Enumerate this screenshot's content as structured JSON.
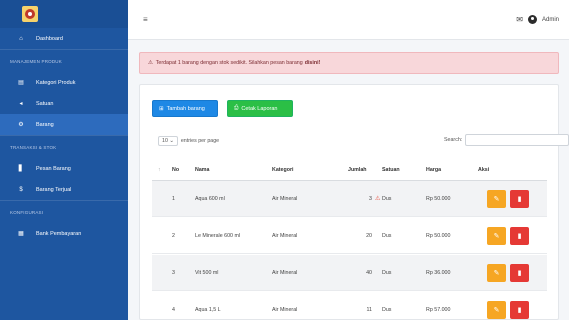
{
  "sidebar": {
    "items": [
      {
        "type": "item",
        "label": "Dashboard",
        "icon": "home-icon",
        "glyph": "⌂"
      },
      {
        "type": "section",
        "label": "MANAJEMEN PRODUK"
      },
      {
        "type": "item",
        "label": "Kategori Produk",
        "icon": "category-icon",
        "glyph": "▤"
      },
      {
        "type": "item",
        "label": "Satuan",
        "icon": "tag-icon",
        "glyph": "◂"
      },
      {
        "type": "item",
        "label": "Barang",
        "icon": "box-icon",
        "glyph": "⚙",
        "active": true
      },
      {
        "type": "section",
        "label": "TRANSAKSI & STOK"
      },
      {
        "type": "item",
        "label": "Pesan Barang",
        "icon": "order-icon",
        "glyph": "▋"
      },
      {
        "type": "item",
        "label": "Barang Terjual",
        "icon": "sold-icon",
        "glyph": "$"
      },
      {
        "type": "section",
        "label": "KONFIGURASI"
      },
      {
        "type": "item",
        "label": "Bank Pembayaran",
        "icon": "bank-icon",
        "glyph": "▦"
      }
    ]
  },
  "topbar": {
    "menu_glyph": "≡",
    "mail_glyph": "✉",
    "user_name": "Admin"
  },
  "alert": {
    "glyph": "⚠",
    "text": "Terdapat 1 barang dengan stok sedikit. Silahkan pesan barang",
    "emphasis": "disini!"
  },
  "buttons": {
    "add_label": "Tambah barang",
    "add_glyph": "⊞",
    "print_label": "Cetak Laporan",
    "print_glyph": "⎙"
  },
  "controls": {
    "entries_value": "10",
    "entries_label": "entries per page",
    "search_label": "Search:"
  },
  "table": {
    "headers": {
      "sort": "↑",
      "no": "No",
      "nama": "Nama",
      "kategori": "Kategori",
      "jumlah": "Jumlah",
      "satuan": "Satuan",
      "harga": "Harga",
      "aksi": "Aksi"
    },
    "rows": [
      {
        "no": "1",
        "nama": "Aqua 600 ml",
        "kategori": "Air Mineral",
        "jumlah": "3",
        "low_stock": true,
        "satuan": "Dus",
        "harga": "Rp 50.000"
      },
      {
        "no": "2",
        "nama": "Le Minerale 600 ml",
        "kategori": "Air Mineral",
        "jumlah": "20",
        "low_stock": false,
        "satuan": "Dus",
        "harga": "Rp 50.000"
      },
      {
        "no": "3",
        "nama": "Vit 500 ml",
        "kategori": "Air Mineral",
        "jumlah": "40",
        "low_stock": false,
        "satuan": "Dus",
        "harga": "Rp 36.000"
      },
      {
        "no": "4",
        "nama": "Aqua 1,5 L",
        "kategori": "Air Mineral",
        "jumlah": "11",
        "low_stock": false,
        "satuan": "Dus",
        "harga": "Rp 57.000"
      }
    ]
  },
  "colors": {
    "sidebar": "#1e56a0",
    "alert_bg": "#f8d7da",
    "btn_blue": "#1e88e5",
    "btn_green": "#2bbf46",
    "btn_edit": "#f6a623",
    "btn_delete": "#e53935"
  }
}
